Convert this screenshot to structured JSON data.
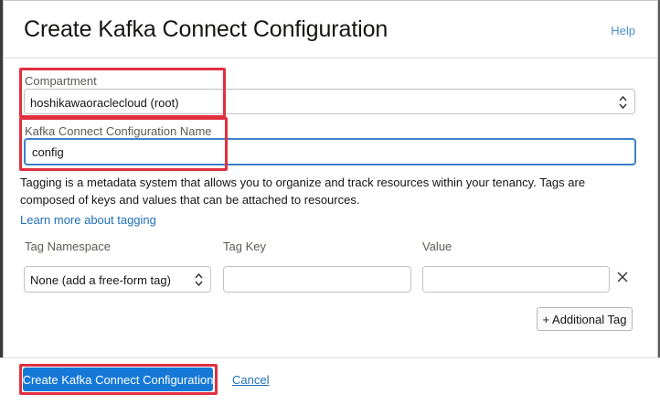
{
  "dialog": {
    "title": "Create Kafka Connect Configuration",
    "help_label": "Help"
  },
  "compartment": {
    "label": "Compartment",
    "value": "hoshikawaoraclecloud (root)"
  },
  "config_name": {
    "label": "Kafka Connect Configuration Name",
    "value": "config"
  },
  "tagging": {
    "info": "Tagging is a metadata system that allows you to organize and track resources within your tenancy. Tags are composed of keys and values that can be attached to resources.",
    "learn_more": "Learn more about tagging",
    "namespace_header": "Tag Namespace",
    "key_header": "Tag Key",
    "value_header": "Value",
    "namespace_value": "None (add a free-form tag)",
    "key_value": "",
    "value_value": "",
    "remove_icon": "close-icon",
    "add_label": "+ Additional Tag"
  },
  "footer": {
    "create_label": "Create Kafka Connect Configuration",
    "cancel_label": "Cancel"
  },
  "colors": {
    "primary": "#1578d6",
    "link": "#1f6fb8",
    "highlight": "#e0303f",
    "focus": "#3b82c8"
  }
}
